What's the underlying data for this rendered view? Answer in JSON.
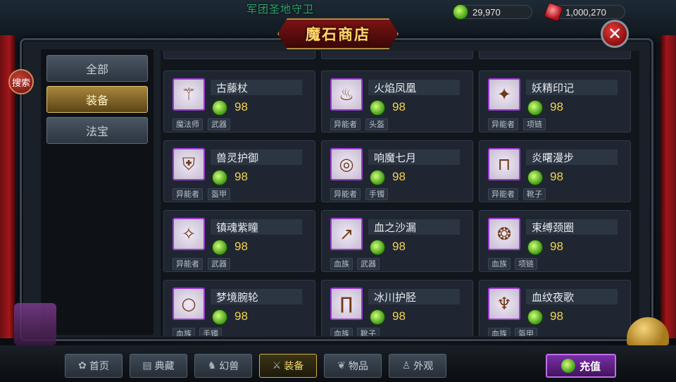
{
  "header": {
    "title": "魔石商店",
    "faction_banner": "军团圣地守卫",
    "currency_green": "29,970",
    "currency_ruby": "1,000,270",
    "close": "✕",
    "search": "搜索"
  },
  "sidebar": {
    "items": [
      {
        "label": "全部",
        "active": false
      },
      {
        "label": "装备",
        "active": true
      },
      {
        "label": "法宝",
        "active": false
      }
    ]
  },
  "items": [
    {
      "name": "古藤杖",
      "price": "98",
      "tags": [
        "魔法师",
        "武器"
      ],
      "icon": "staff-icon"
    },
    {
      "name": "火焰凤凰",
      "price": "98",
      "tags": [
        "异能者",
        "头盔"
      ],
      "icon": "phoenix-icon"
    },
    {
      "name": "妖精印记",
      "price": "98",
      "tags": [
        "异能者",
        "项链"
      ],
      "icon": "amulet-icon"
    },
    {
      "name": "兽灵护御",
      "price": "98",
      "tags": [
        "异能者",
        "盔甲"
      ],
      "icon": "armor-icon"
    },
    {
      "name": "响魔七月",
      "price": "98",
      "tags": [
        "异能者",
        "手镯"
      ],
      "icon": "bracelet-icon"
    },
    {
      "name": "炎曙漫步",
      "price": "98",
      "tags": [
        "异能者",
        "靴子"
      ],
      "icon": "boots-icon"
    },
    {
      "name": "镇魂紫瞳",
      "price": "98",
      "tags": [
        "异能者",
        "武器"
      ],
      "icon": "scepter-icon"
    },
    {
      "name": "血之沙漏",
      "price": "98",
      "tags": [
        "血族",
        "武器"
      ],
      "icon": "spear-icon"
    },
    {
      "name": "束缚颈圈",
      "price": "98",
      "tags": [
        "血族",
        "项链"
      ],
      "icon": "necklace-icon"
    },
    {
      "name": "梦境腕轮",
      "price": "98",
      "tags": [
        "血族",
        "手镯"
      ],
      "icon": "ring-icon"
    },
    {
      "name": "冰川护胫",
      "price": "98",
      "tags": [
        "血族",
        "靴子"
      ],
      "icon": "greaves-icon"
    },
    {
      "name": "血纹夜歌",
      "price": "98",
      "tags": [
        "血族",
        "盔甲"
      ],
      "icon": "cloak-icon"
    }
  ],
  "bottom_tabs": [
    {
      "label": "首页",
      "icon": "flower-icon",
      "active": false
    },
    {
      "label": "典藏",
      "icon": "scroll-icon",
      "active": false
    },
    {
      "label": "幻兽",
      "icon": "beast-icon",
      "active": false
    },
    {
      "label": "装备",
      "icon": "sword-icon",
      "active": true
    },
    {
      "label": "物品",
      "icon": "leaf-icon",
      "active": false
    },
    {
      "label": "外观",
      "icon": "shirt-icon",
      "active": false
    }
  ],
  "recharge_label": "充值",
  "colors": {
    "accent_gold": "#f4d34e",
    "item_border": "#9b3bd2",
    "active_tab": "#d3ae3e"
  }
}
